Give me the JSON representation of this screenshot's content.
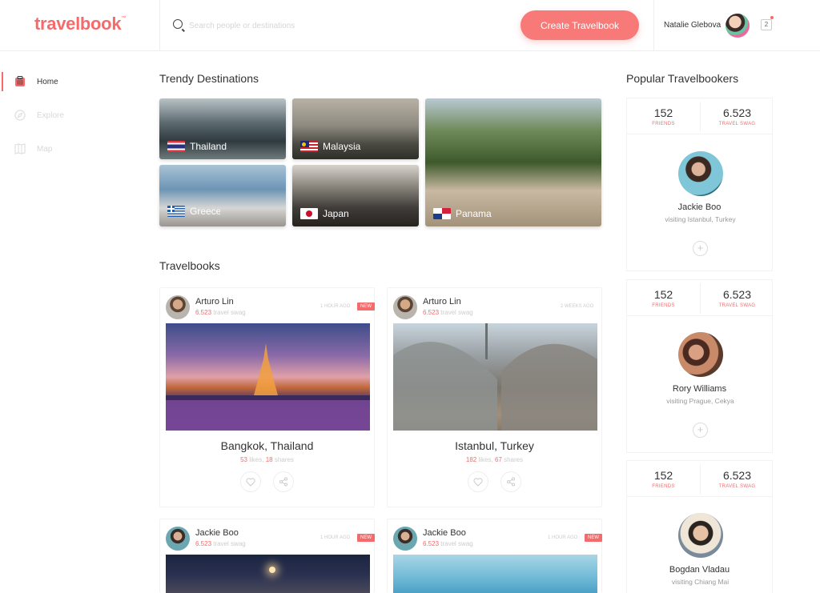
{
  "app": {
    "logo": "travelbook",
    "logo_mark": "™"
  },
  "header": {
    "search_placeholder": "Search people or destinations",
    "create_button": "Create Travelbook",
    "user_name": "Natalie Glebova",
    "notification_count": "2"
  },
  "sidebar": {
    "items": [
      {
        "label": "Home",
        "icon": "travelbook-icon",
        "active": true
      },
      {
        "label": "Explore",
        "icon": "compass-icon",
        "active": false
      },
      {
        "label": "Map",
        "icon": "map-icon",
        "active": false
      }
    ]
  },
  "destinations": {
    "title": "Trendy Destinations",
    "items": [
      {
        "name": "Thailand",
        "flag": "thailand-flag-icon"
      },
      {
        "name": "Malaysia",
        "flag": "malaysia-flag-icon"
      },
      {
        "name": "Panama",
        "flag": "panama-flag-icon"
      },
      {
        "name": "Greece",
        "flag": "greece-flag-icon"
      },
      {
        "name": "Japan",
        "flag": "japan-flag-icon"
      }
    ]
  },
  "travelbooks": {
    "title": "Travelbooks",
    "swag_suffix": "travel swag",
    "likes_word": "likes,",
    "shares_word": "shares",
    "cards": [
      {
        "author": "Arturo Lin",
        "swag": "6.523",
        "time": "1 HOUR AGO",
        "badge": "NEW",
        "place": "Bangkok, Thailand",
        "likes": "53",
        "shares": "18"
      },
      {
        "author": "Arturo Lin",
        "swag": "6.523",
        "time": "2 WEEKS AGO",
        "badge": "",
        "place": "Istanbul, Turkey",
        "likes": "182",
        "shares": "67"
      },
      {
        "author": "Jackie Boo",
        "swag": "6.523",
        "time": "1 HOUR AGO",
        "badge": "NEW"
      },
      {
        "author": "Jackie Boo",
        "swag": "6.523",
        "time": "1 HOUR AGO",
        "badge": "NEW"
      }
    ]
  },
  "popular": {
    "title": "Popular Travelbookers",
    "people": [
      {
        "friends": "152",
        "friends_label": "FRIENDS",
        "swag": "6.523",
        "swag_label": "TRAVEL SWAG",
        "name": "Jackie Boo",
        "visiting": "visiting Istanbul, Turkey"
      },
      {
        "friends": "152",
        "friends_label": "FRIENDS",
        "swag": "6.523",
        "swag_label": "TRAVEL SWAG",
        "name": "Rory Williams",
        "visiting": "visiting Prague, Cekya"
      },
      {
        "friends": "152",
        "friends_label": "FRIENDS",
        "swag": "6.523",
        "swag_label": "TRAVEL SWAG",
        "name": "Bogdan Vladau",
        "visiting": "visiting Chiang Mai"
      }
    ]
  },
  "colors": {
    "accent": "#f56b6b",
    "button": "#f77a78"
  }
}
